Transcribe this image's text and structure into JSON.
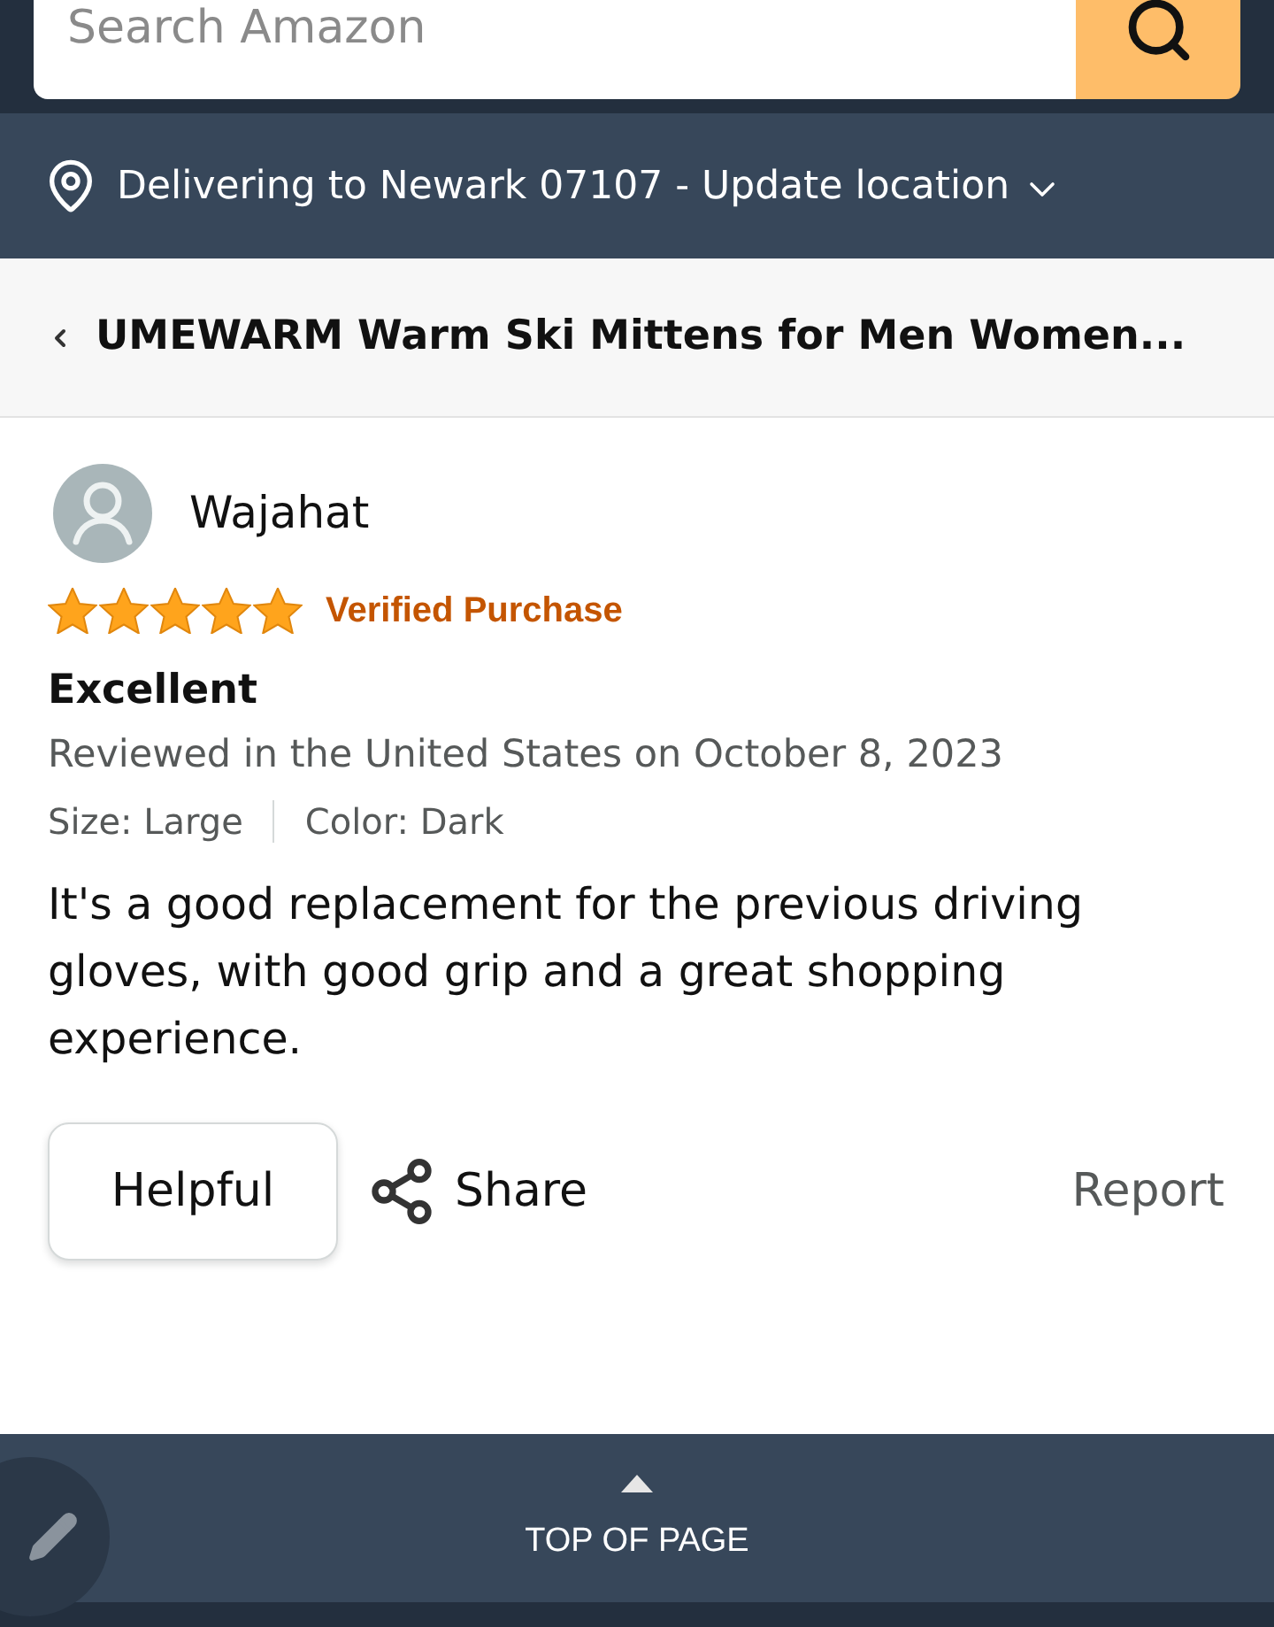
{
  "search": {
    "placeholder": "Search Amazon"
  },
  "delivery": {
    "text": "Delivering to Newark 07107 - Update location"
  },
  "product": {
    "title": "UMEWARM Warm Ski Mittens for Men Women..."
  },
  "review": {
    "reviewer": "Wajahat",
    "stars": 5,
    "badge": "Verified Purchase",
    "title": "Excellent",
    "meta": "Reviewed in the United States on October 8, 2023",
    "variants": [
      "Size: Large",
      "Color: Dark"
    ],
    "body": "It's a good replacement for the previous driving gloves, with good grip and a great shopping experience.",
    "actions": {
      "helpful": "Helpful",
      "share": "Share",
      "report": "Report"
    }
  },
  "footer": {
    "label": "TOP OF PAGE"
  }
}
